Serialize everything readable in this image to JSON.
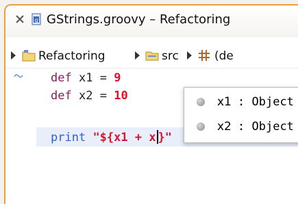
{
  "tab": {
    "title": "GStrings.groovy – Refactoring",
    "close_icon": "close-icon",
    "file_icon": "groovy-file-icon"
  },
  "breadcrumb": {
    "items": [
      {
        "label": "Refactoring",
        "icon": "project-icon"
      },
      {
        "label": "src",
        "icon": "source-folder-icon"
      },
      {
        "label": "(de",
        "icon": "package-icon"
      }
    ]
  },
  "editor": {
    "lines": [
      {
        "keyword": "def",
        "name": "x1",
        "op": "=",
        "value": "9"
      },
      {
        "keyword": "def",
        "name": "x2",
        "op": "=",
        "value": "10"
      }
    ],
    "current_line": {
      "keyword": "print",
      "string_prefix": "\"${x1 + x",
      "string_suffix": "}\""
    }
  },
  "autocomplete": {
    "items": [
      {
        "name": "x1",
        "sep": ":",
        "type": "Object"
      },
      {
        "name": "x2",
        "sep": ":",
        "type": "Object"
      }
    ]
  },
  "colors": {
    "tab_border": "#e3a23d",
    "keyword": "#8a1d5c",
    "number": "#e0102a",
    "print_keyword": "#2f5fd8",
    "current_line": "#e8eefa"
  }
}
